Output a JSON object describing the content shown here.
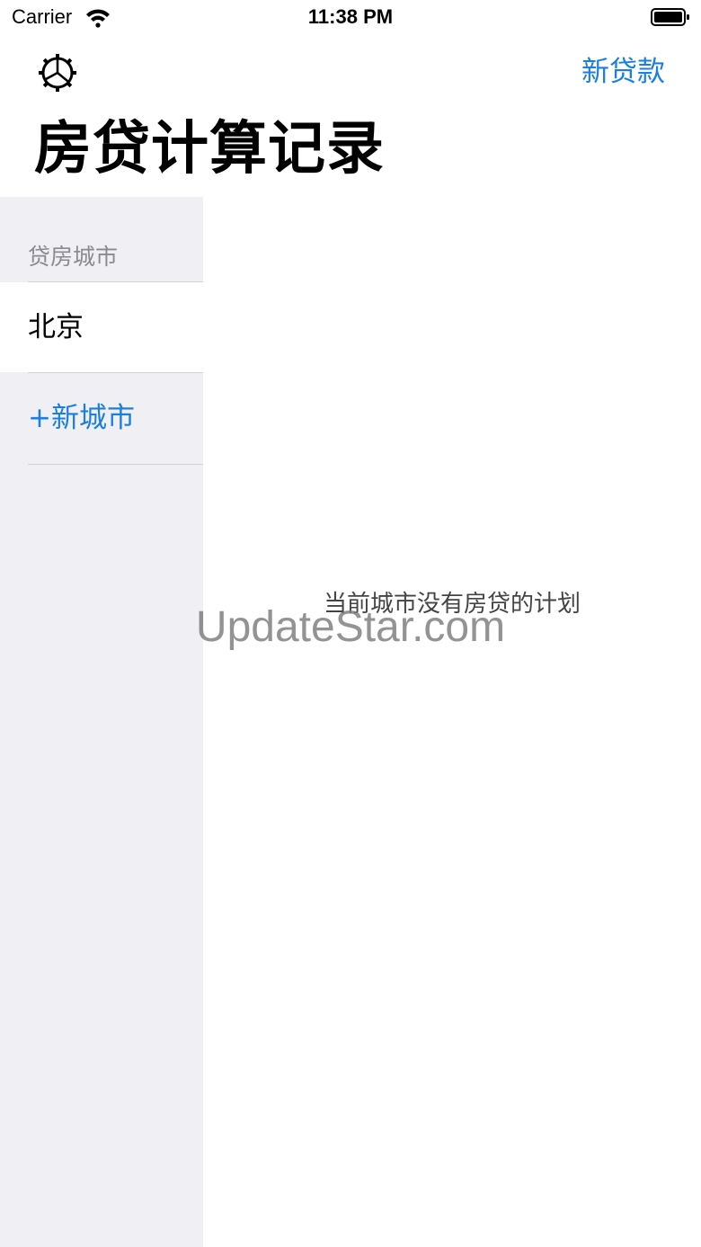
{
  "status_bar": {
    "carrier": "Carrier",
    "time": "11:38 PM"
  },
  "nav": {
    "settings_icon": "gear-icon",
    "new_loan_label": "新贷款",
    "accent_color": "#1a7fe0"
  },
  "title": "房贷计算记录",
  "sidebar": {
    "section_header": "贷房城市",
    "cities": [
      {
        "label": "北京"
      }
    ],
    "add_city_label": "+新城市",
    "background_color": "#efeff4"
  },
  "main": {
    "empty_message": "当前城市没有房贷的计划"
  },
  "watermark": "UpdateStar.com"
}
